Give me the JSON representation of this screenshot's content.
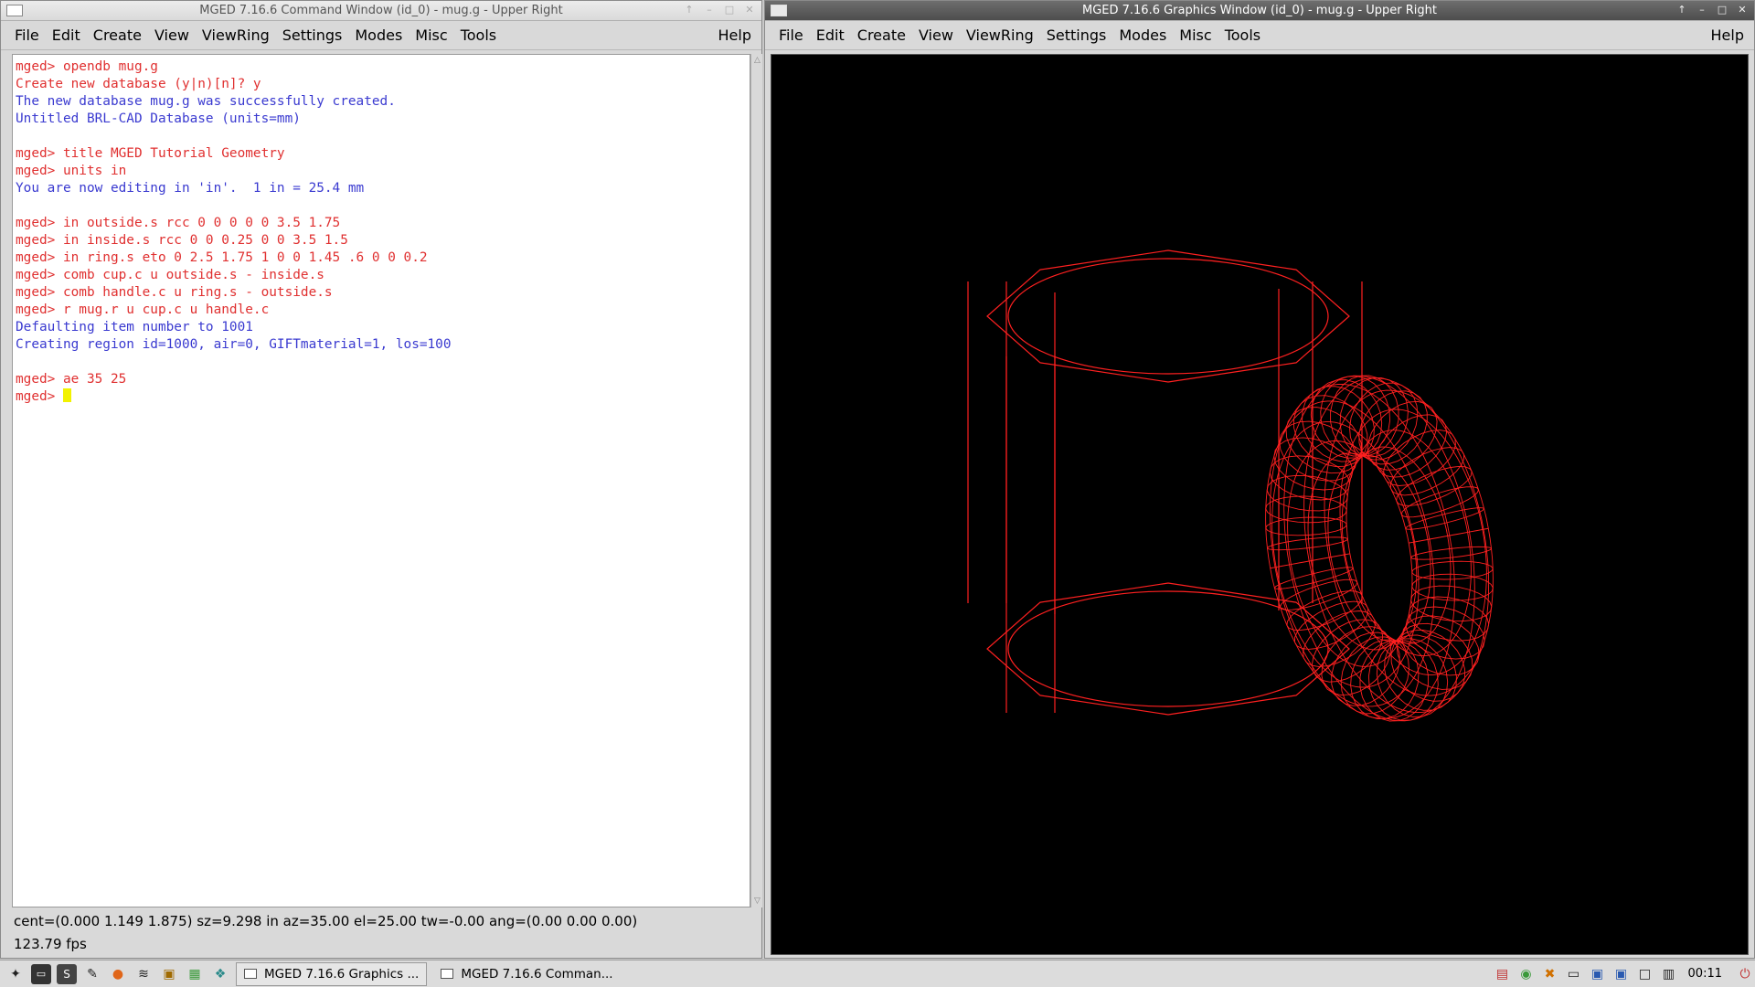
{
  "command_window": {
    "title": "MGED 7.16.6 Command Window (id_0) - mug.g - Upper Right",
    "menu": [
      "File",
      "Edit",
      "Create",
      "View",
      "ViewRing",
      "Settings",
      "Modes",
      "Misc",
      "Tools"
    ],
    "help": "Help",
    "console_lines": [
      {
        "text": "mged> opendb mug.g",
        "color": "red"
      },
      {
        "text": "Create new database (y|n)[n]? y",
        "color": "red"
      },
      {
        "text": "The new database mug.g was successfully created.",
        "color": "blue"
      },
      {
        "text": "Untitled BRL-CAD Database (units=mm)",
        "color": "blue"
      },
      {
        "text": "",
        "color": "red"
      },
      {
        "text": "mged> title MGED Tutorial Geometry",
        "color": "red"
      },
      {
        "text": "mged> units in",
        "color": "red"
      },
      {
        "text": "You are now editing in 'in'.  1 in = 25.4 mm",
        "color": "blue"
      },
      {
        "text": "",
        "color": "red"
      },
      {
        "text": "mged> in outside.s rcc 0 0 0 0 0 3.5 1.75",
        "color": "red"
      },
      {
        "text": "mged> in inside.s rcc 0 0 0.25 0 0 3.5 1.5",
        "color": "red"
      },
      {
        "text": "mged> in ring.s eto 0 2.5 1.75 1 0 0 1.45 .6 0 0 0.2",
        "color": "red"
      },
      {
        "text": "mged> comb cup.c u outside.s - inside.s",
        "color": "red"
      },
      {
        "text": "mged> comb handle.c u ring.s - outside.s",
        "color": "red"
      },
      {
        "text": "mged> r mug.r u cup.c u handle.c",
        "color": "red"
      },
      {
        "text": "Defaulting item number to 1001",
        "color": "blue"
      },
      {
        "text": "Creating region id=1000, air=0, GIFTmaterial=1, los=100",
        "color": "blue"
      },
      {
        "text": "",
        "color": "red"
      },
      {
        "text": "mged> ae 35 25",
        "color": "red"
      }
    ],
    "prompt": "mged> ",
    "status_line": "cent=(0.000 1.149 1.875) sz=9.298  in  az=35.00  el=25.00  tw=-0.00  ang=(0.00 0.00 0.00)",
    "fps": "123.79 fps"
  },
  "graphics_window": {
    "title": "MGED 7.16.6 Graphics Window (id_0) - mug.g - Upper Right",
    "menu": [
      "File",
      "Edit",
      "Create",
      "View",
      "ViewRing",
      "Settings",
      "Modes",
      "Misc",
      "Tools"
    ],
    "help": "Help",
    "wire_color": "#ff2020"
  },
  "taskbar": {
    "tasks": [
      "MGED 7.16.6 Graphics ...",
      "MGED 7.16.6 Comman..."
    ],
    "clock": "00:11"
  },
  "colors": {
    "red": "#e03030",
    "blue": "#3a3ad0"
  }
}
